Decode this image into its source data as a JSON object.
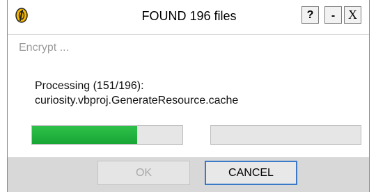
{
  "window": {
    "title": "FOUND 196 files",
    "buttons": {
      "help": "?",
      "minimize": "-",
      "close": "X"
    }
  },
  "section": {
    "label": "Encrypt ..."
  },
  "status": {
    "line1": "Processing (151/196):",
    "line2": "curiosity.vbproj.GenerateResource.cache"
  },
  "progress": {
    "current": 151,
    "total": 196,
    "file_fraction": 0.7,
    "secondary_fraction": 0.0,
    "fill_color": "#1fae3c"
  },
  "footer": {
    "ok_label": "OK",
    "cancel_label": "CANCEL"
  },
  "colors": {
    "accent": "#3a78c8",
    "footer_bg": "#d8d8d8"
  }
}
